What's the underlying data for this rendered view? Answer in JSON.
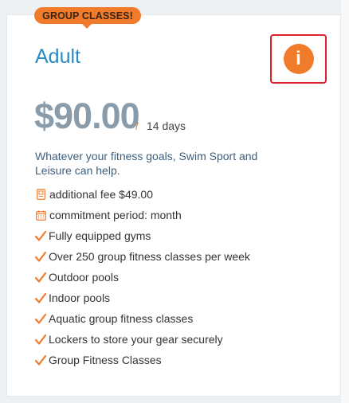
{
  "card": {
    "badge": "GROUP CLASSES!",
    "plan_name": "Adult",
    "info_icon": "info-icon",
    "price": "$90.00",
    "price_separator": "/",
    "period": "14 days",
    "description": "Whatever your fitness goals, Swim Sport and Leisure can help.",
    "features": [
      {
        "icon": "fee-icon",
        "text": "additional fee $49.00"
      },
      {
        "icon": "calendar-icon",
        "text": "commitment period: month"
      },
      {
        "icon": "check-icon",
        "text": "Fully equipped gyms"
      },
      {
        "icon": "check-icon",
        "text": "Over 250 group fitness classes per week"
      },
      {
        "icon": "check-icon",
        "text": "Outdoor pools"
      },
      {
        "icon": "check-icon",
        "text": "Indoor pools"
      },
      {
        "icon": "check-icon",
        "text": "Aquatic group fitness classes"
      },
      {
        "icon": "check-icon",
        "text": "Lockers to store your gear securely"
      },
      {
        "icon": "check-icon",
        "text": "Group Fitness Classes"
      }
    ]
  },
  "colors": {
    "accent": "#f07b2b",
    "title": "#2a8ac6",
    "price": "#8a9caa",
    "description": "#3d5f7d",
    "highlight_border": "#e0202a"
  }
}
